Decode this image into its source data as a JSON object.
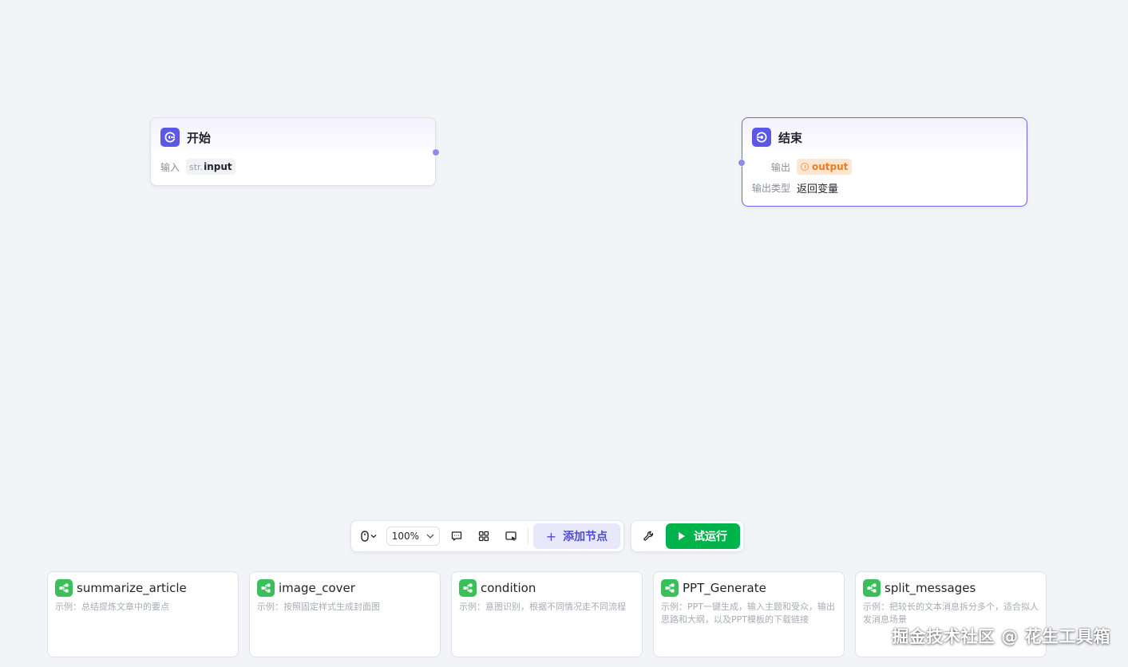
{
  "nodes": {
    "start": {
      "title": "开始",
      "input_label": "输入",
      "var_type": "str.",
      "var_name": "input"
    },
    "end": {
      "title": "结束",
      "output_label": "输出",
      "output_var": "output",
      "output_type_label": "输出类型",
      "output_type_value": "返回变量"
    }
  },
  "toolbar": {
    "zoom": "100%",
    "add_node_label": "添加节点",
    "run_label": "试运行"
  },
  "templates": [
    {
      "title": "summarize_article",
      "desc": "示例：总结提炼文章中的要点"
    },
    {
      "title": "image_cover",
      "desc": "示例：按照固定样式生成封面图"
    },
    {
      "title": "condition",
      "desc": "示例：意图识别，根据不同情况走不同流程"
    },
    {
      "title": "PPT_Generate",
      "desc": "示例：PPT一键生成，输入主题和受众，输出思路和大纲，以及PPT模板的下载链接"
    },
    {
      "title": "split_messages",
      "desc": "示例：把较长的文本消息拆分多个，适合拟人发消息场景"
    }
  ],
  "watermark": "掘金技术社区 @ 花生工具箱",
  "colors": {
    "canvas_bg": "#f3f4f8",
    "node_icon": "#5b58e6",
    "selected_border": "#6b64e8",
    "port": "#8f8bf0",
    "output_tag_bg": "#fde7d4",
    "output_tag_text": "#f07b1a",
    "add_node_bg": "#e9e8fb",
    "add_node_text": "#4d49d8",
    "run_button": "#00b34a",
    "template_icon": "#3cbf5a"
  },
  "icons": {
    "start_node": "start-node-icon",
    "end_node": "end-node-icon",
    "pointer_mode": "mouse-icon",
    "comment": "comment-icon",
    "auto_layout": "grid-icon",
    "minimap": "minimap-icon",
    "add": "plus-icon",
    "settings": "wrench-icon",
    "run": "play-icon",
    "template": "workflow-icon"
  }
}
